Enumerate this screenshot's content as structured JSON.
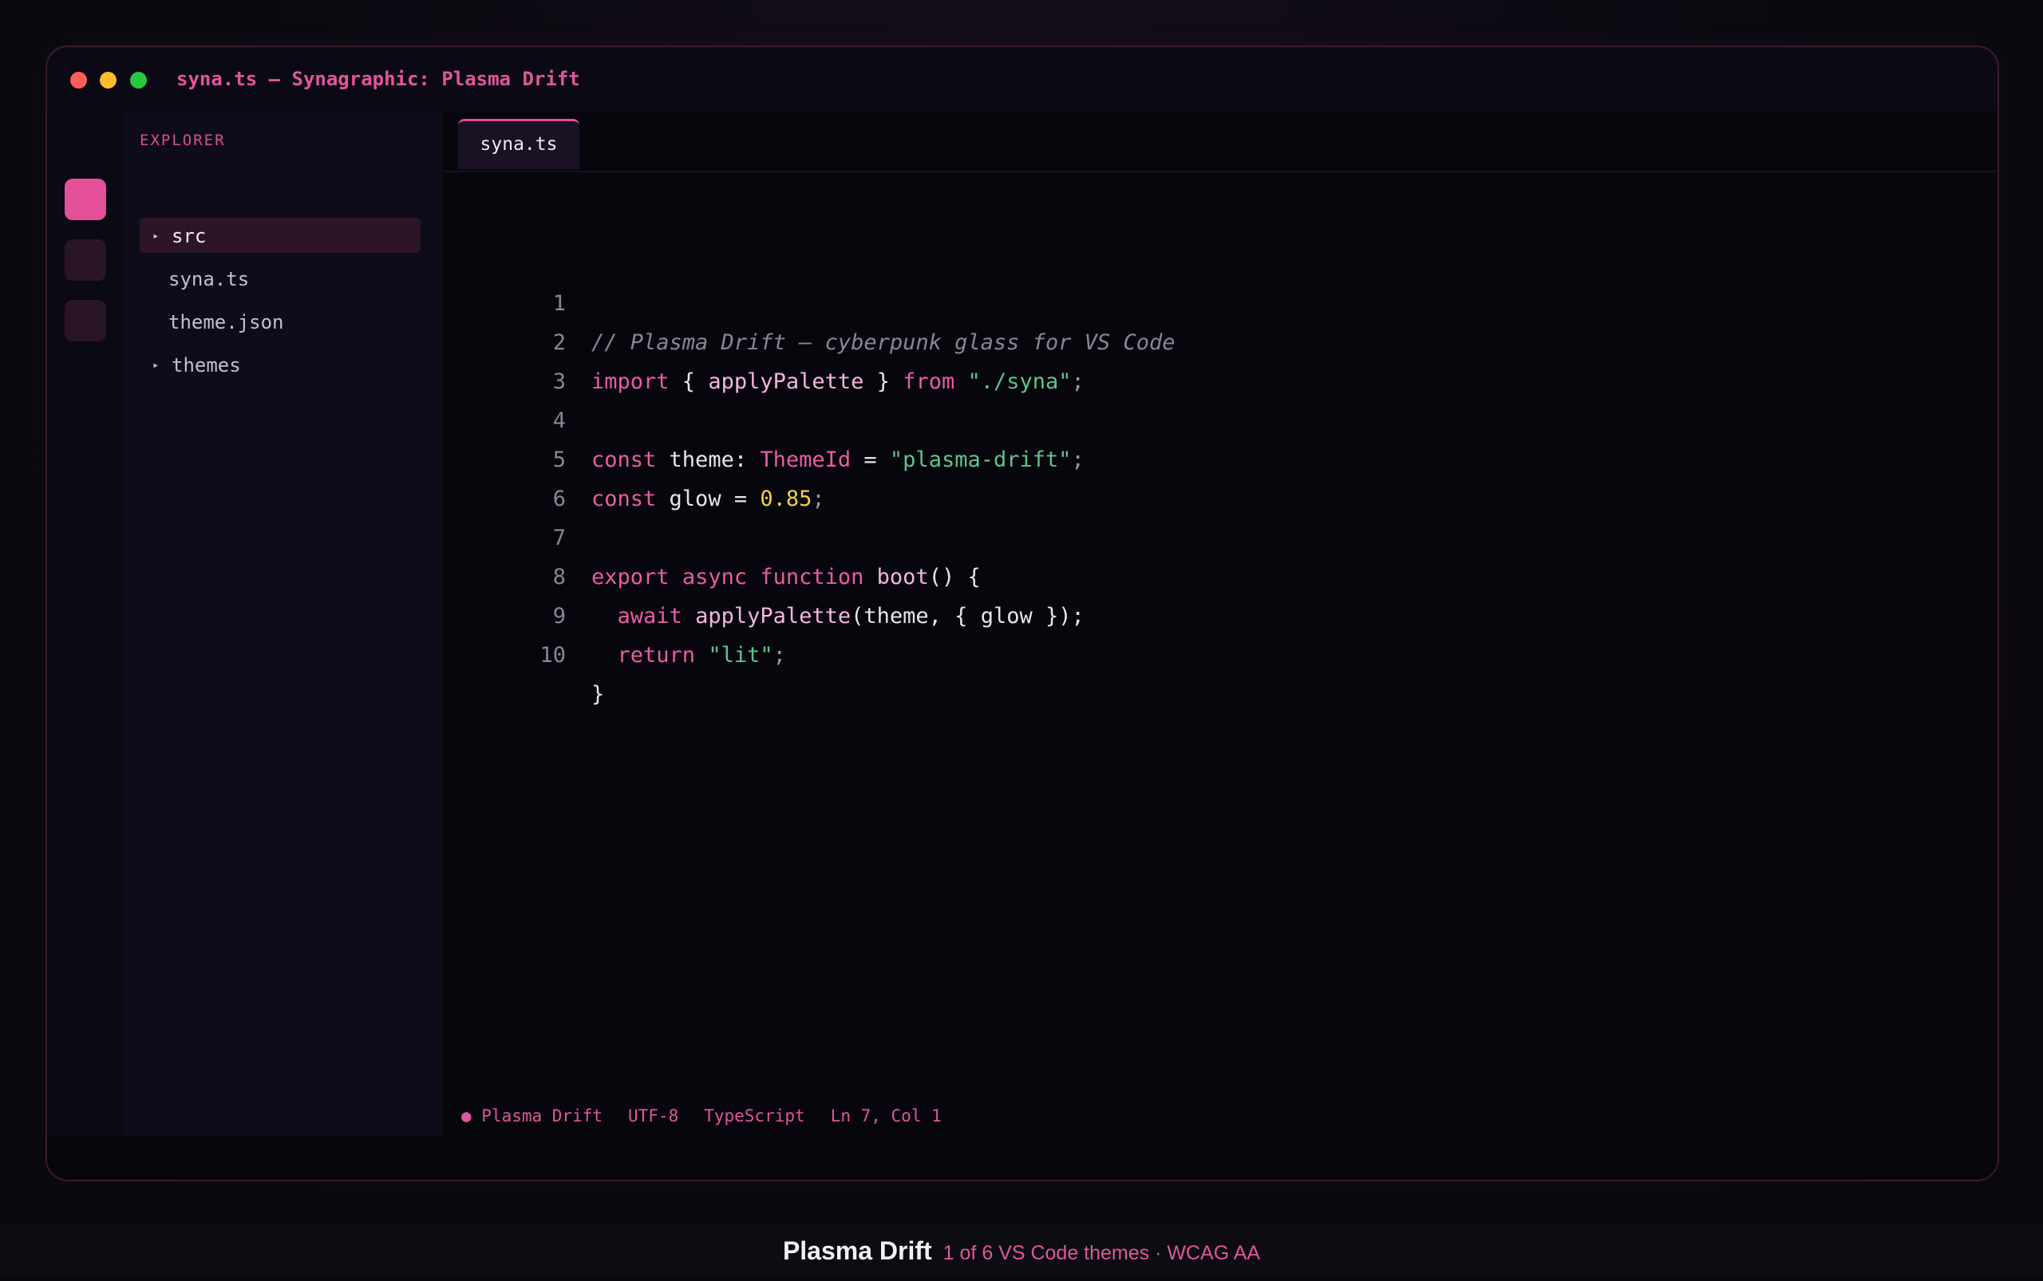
{
  "window": {
    "title": "syna.ts — Synagraphic: Plasma Drift"
  },
  "activity_bar": {
    "icons": [
      "explorer-icon",
      "search-icon",
      "extensions-icon"
    ],
    "accent_color": "#e5509b"
  },
  "sidebar": {
    "title": "EXPLORER",
    "items": [
      {
        "label": "src",
        "type": "folder",
        "caret": "▸",
        "selected": true
      },
      {
        "label": "syna.ts",
        "type": "file"
      },
      {
        "label": "theme.json",
        "type": "file"
      },
      {
        "label": "themes",
        "type": "folder",
        "caret": "▸"
      }
    ]
  },
  "editor": {
    "tabs": [
      {
        "label": "syna.ts",
        "active": true
      }
    ],
    "lines": [
      {
        "n": "1"
      },
      {
        "n": "2"
      },
      {
        "n": "3"
      },
      {
        "n": "4"
      },
      {
        "n": "5"
      },
      {
        "n": "6"
      },
      {
        "n": "7"
      },
      {
        "n": "8"
      },
      {
        "n": "9"
      },
      {
        "n": "10"
      }
    ],
    "code": {
      "l1": "// Plasma Drift — cyberpunk glass for VS Code",
      "l2": {
        "kw1": "import",
        "p1": " { ",
        "fn": "applyPalette",
        "p2": " } ",
        "kw2": "from",
        "sp": " ",
        "str": "\"./syna\"",
        "semi": ";"
      },
      "l4": {
        "kw": "const",
        "sp1": " ",
        "id": "theme",
        "colon": ": ",
        "type": "ThemeId",
        "eq": " = ",
        "str": "\"plasma-drift\"",
        "semi": ";"
      },
      "l5": {
        "kw": "const",
        "sp1": " ",
        "id": "glow",
        "eq": " = ",
        "num": "0.85",
        "semi": ";"
      },
      "l7": {
        "kw1": "export",
        "sp1": " ",
        "kw2": "async",
        "sp2": " ",
        "kw3": "function",
        "sp3": " ",
        "fn": "boot",
        "rest": "() {"
      },
      "l8": {
        "indent": "  ",
        "kw": "await",
        "sp": " ",
        "fn": "applyPalette",
        "rest": "(theme, { glow });"
      },
      "l9": {
        "indent": "  ",
        "kw": "return",
        "sp": " ",
        "str": "\"lit\"",
        "semi": ";"
      },
      "l10": "}"
    }
  },
  "statusbar": {
    "theme": "● Plasma Drift",
    "encoding": "UTF-8",
    "language": "TypeScript",
    "position": "Ln 7, Col 1"
  },
  "caption": {
    "title": "Plasma Drift",
    "subtitle": "1 of 6 VS Code themes · WCAG AA"
  },
  "colors": {
    "accent": "#e5509b",
    "keyword": "#ea5ca4",
    "string": "#5fc48a",
    "number": "#f0d04a",
    "comment": "#8a8596",
    "background": "#07060d"
  }
}
